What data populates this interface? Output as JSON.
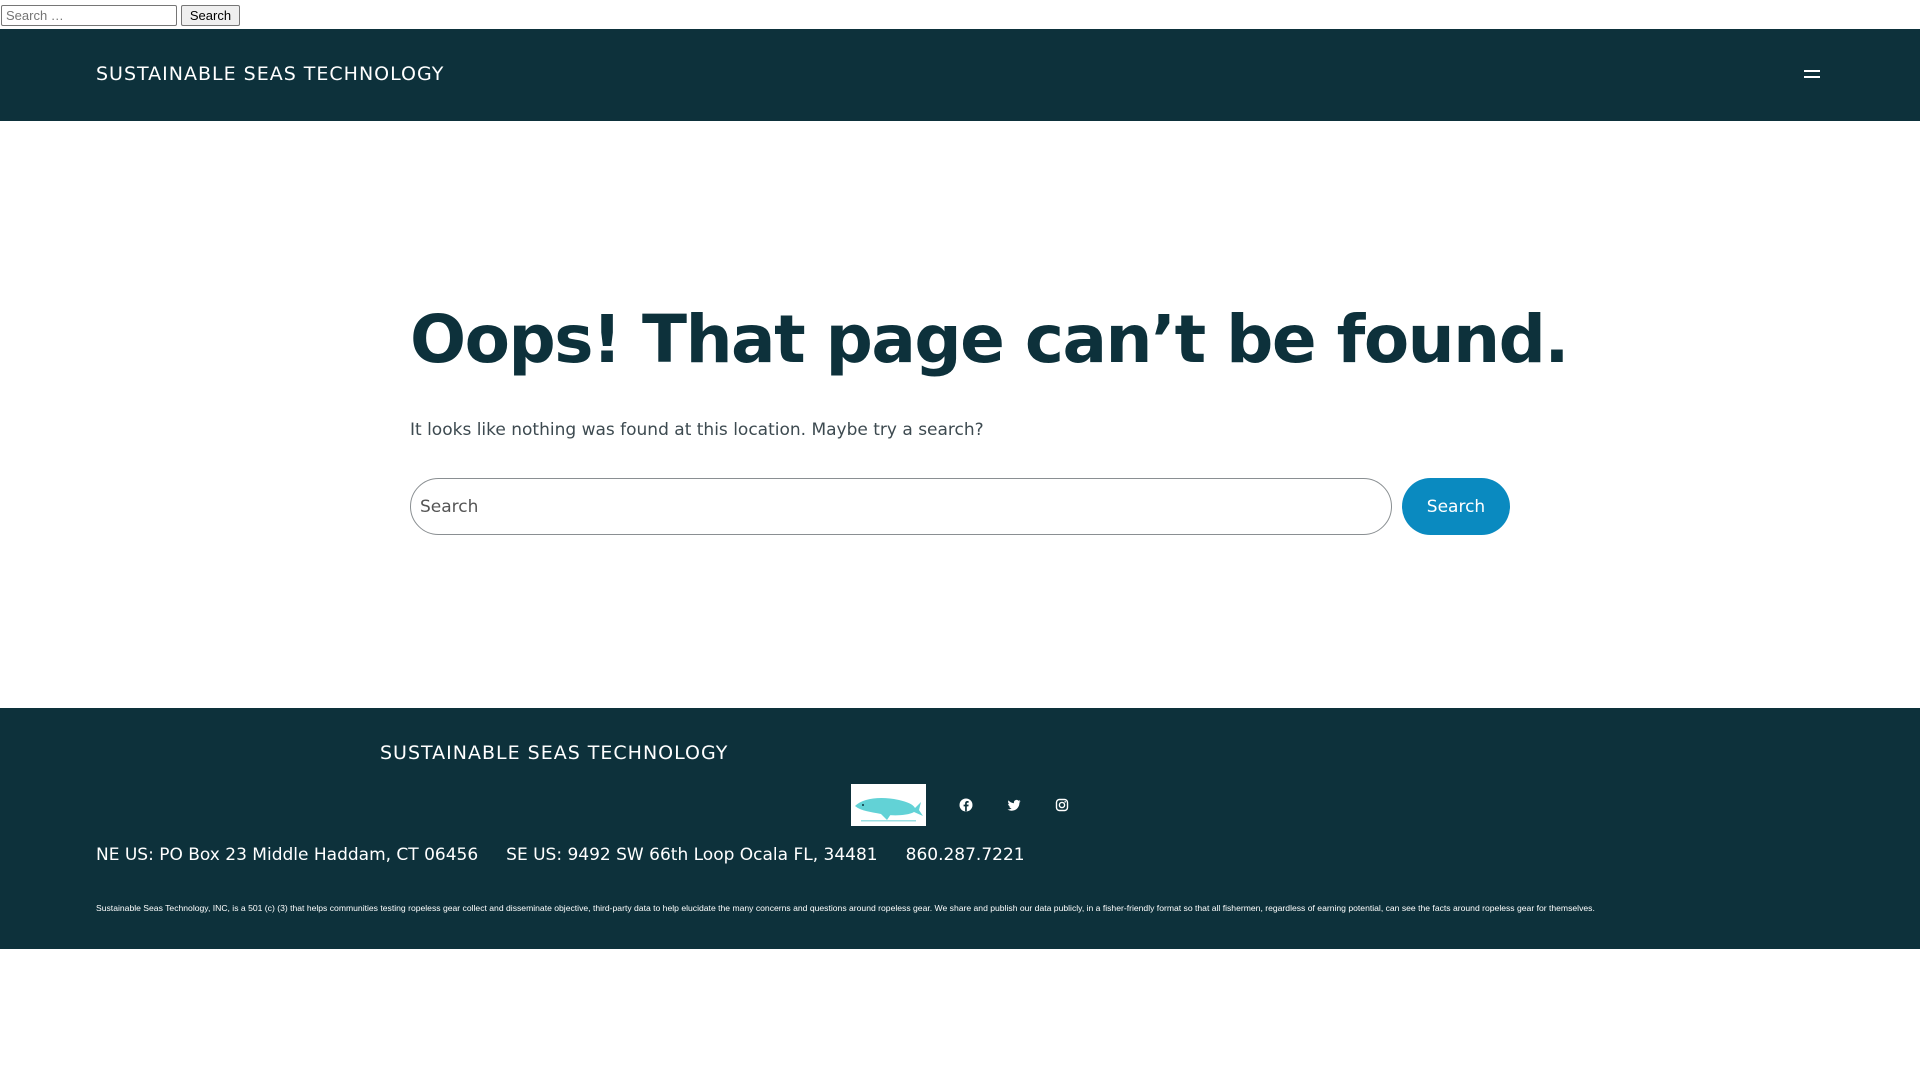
{
  "util_search": {
    "placeholder": "Search …",
    "button_label": "Search"
  },
  "header": {
    "site_title": "SUSTAINABLE SEAS TECHNOLOGY",
    "menu_icon": "hamburger-menu-icon"
  },
  "main": {
    "title": "Oops! That page can’t be found.",
    "description": "It looks like nothing was found at this location. Maybe try a search?",
    "search_placeholder": "Search",
    "search_button_label": "Search"
  },
  "footer": {
    "site_title": "SUSTAINABLE SEAS TECHNOLOGY",
    "logo_icon": "whale-logo",
    "social_icons": [
      "facebook-icon",
      "twitter-icon",
      "instagram-icon"
    ],
    "address_ne": "NE US: PO Box 23 Middle Haddam, CT 06456",
    "address_se": "SE US: 9492 SW 66th Loop Ocala FL, 34481",
    "phone": "860.287.7221",
    "note": "Sustainable Seas Technology, INC, is a 501 (c) (3) that helps communities testing ropeless gear collect and disseminate objective, third-party data to help elucidate the many concerns and questions around ropeless gear. We share and publish our data publicly, in a fisher-friendly format so that all fishermen, regardless of earning potential, can see the facts around ropeless gear for themselves."
  },
  "colors": {
    "header_bg": "#0d313b",
    "title": "#0d313b",
    "accent_button": "#0a8ac0",
    "logo_whale": "#62d2d6"
  }
}
